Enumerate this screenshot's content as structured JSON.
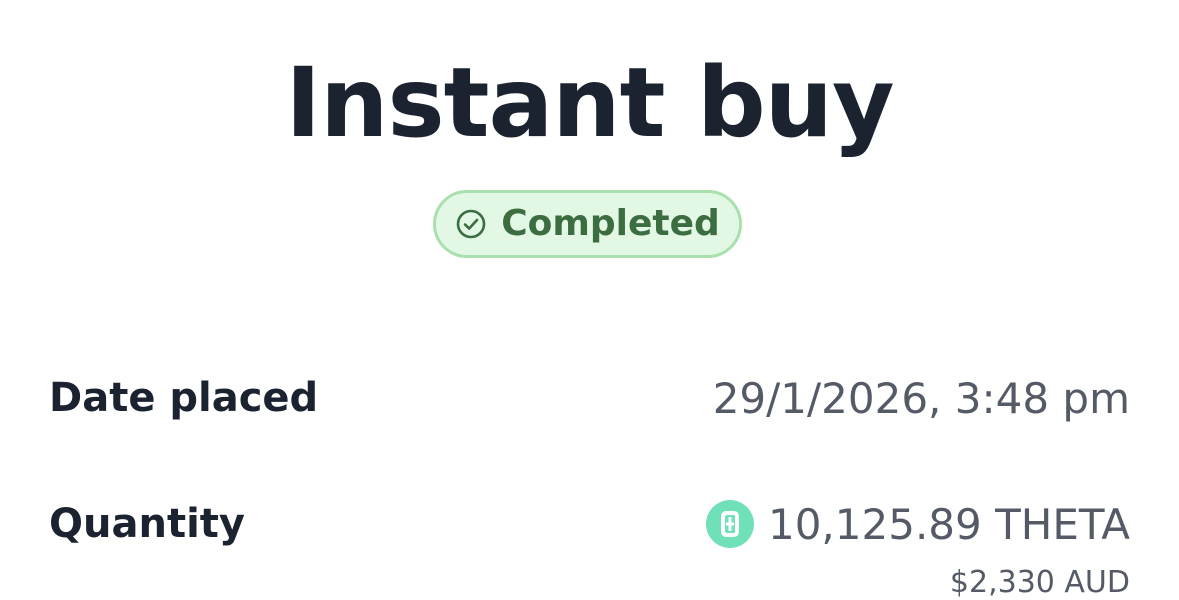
{
  "page": {
    "title": "Instant buy"
  },
  "status": {
    "label": "Completed",
    "icon": "check-circle-icon",
    "colors": {
      "background": "#e3f8e4",
      "border": "#a9e0ad",
      "text": "#3c6d40"
    }
  },
  "details": {
    "date_placed": {
      "label": "Date placed",
      "value": "29/1/2026, 3:48 pm"
    },
    "quantity": {
      "label": "Quantity",
      "value": "10,125.89 THETA",
      "icon": "theta-coin-icon",
      "icon_color": "#6fe0b8",
      "sub_value": "$2,330 AUD"
    }
  }
}
